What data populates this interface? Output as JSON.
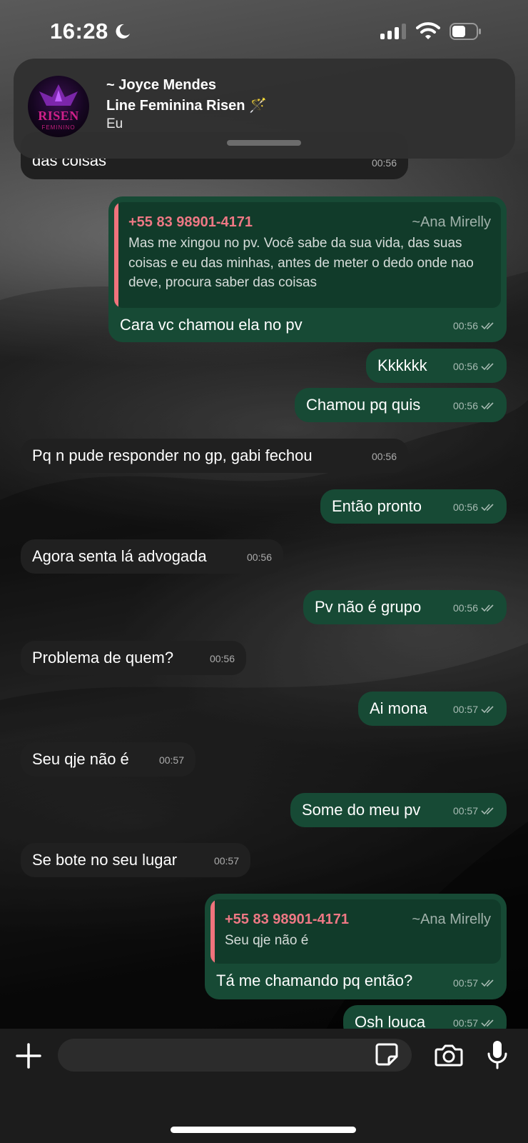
{
  "status_bar": {
    "time": "16:28"
  },
  "notification": {
    "sender": "~ Joyce Mendes",
    "group": "Line Feminina Risen 🪄",
    "subtitle": "Eu",
    "avatar_logo": "RISEN",
    "avatar_logo_sub": "FEMININO"
  },
  "messages": [
    {
      "text": "das coisas",
      "time": "00:56"
    },
    {
      "quote_phone": "+55 83 98901-4171",
      "quote_name": "~Ana Mirelly",
      "quote_text": "Mas me xingou no pv. Você sabe da sua vida, das suas coisas e eu das minhas, antes de meter o dedo onde nao deve, procura saber das coisas",
      "text": "Cara vc chamou ela no pv",
      "time": "00:56"
    },
    {
      "text": "Kkkkkk",
      "time": "00:56"
    },
    {
      "text": "Chamou pq quis",
      "time": "00:56"
    },
    {
      "text": "Pq n pude responder no gp, gabi fechou",
      "time": "00:56"
    },
    {
      "text": "Então pronto",
      "time": "00:56"
    },
    {
      "text": "Agora senta lá advogada",
      "time": "00:56"
    },
    {
      "text": "Pv não é grupo",
      "time": "00:56"
    },
    {
      "text": "Problema de quem?",
      "time": "00:56"
    },
    {
      "text": "Ai mona",
      "time": "00:57"
    },
    {
      "text": "Seu qje não é",
      "time": "00:57"
    },
    {
      "text": "Some do meu pv",
      "time": "00:57"
    },
    {
      "text": "Se bote no seu lugar",
      "time": "00:57"
    },
    {
      "quote_phone": "+55 83 98901-4171",
      "quote_name": "~Ana Mirelly",
      "quote_text": "Seu qje não é",
      "text": "Tá me chamando pq então?",
      "time": "00:57"
    },
    {
      "text": "Osh louca",
      "time": "00:57"
    }
  ],
  "icons": {
    "status": [
      "moon-icon",
      "signal-icon",
      "wifi-icon",
      "battery-icon"
    ],
    "composer": [
      "plus-icon",
      "sticker-icon",
      "camera-icon",
      "microphone-icon"
    ],
    "read": "double-check-icon"
  },
  "colors": {
    "outgoing_bubble": "#174a35",
    "incoming_bubble": "#202020",
    "quote_accent": "#f0737c",
    "quote_phone": "#ee7884"
  }
}
